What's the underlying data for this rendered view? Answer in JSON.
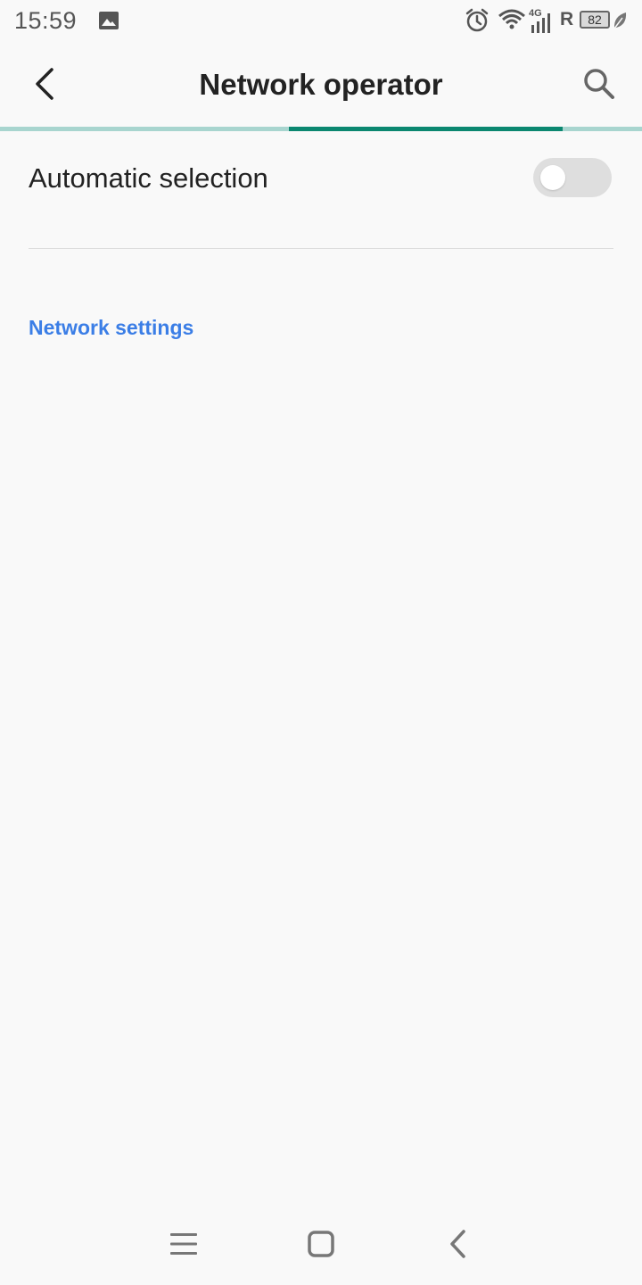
{
  "status_bar": {
    "time": "15:59",
    "network_type": "4G",
    "roaming_indicator": "R",
    "battery_level": "82",
    "icons": [
      "image-icon",
      "alarm-icon",
      "wifi-icon",
      "signal-icon",
      "battery-icon",
      "leaf-icon"
    ]
  },
  "app_bar": {
    "title": "Network operator",
    "back_icon": "chevron-left-icon",
    "search_icon": "search-icon"
  },
  "progress": {
    "fraction": 0.43
  },
  "settings": {
    "automatic_selection": {
      "label": "Automatic selection",
      "enabled": false
    },
    "section_link": "Network settings"
  },
  "nav_bar": {
    "icons": [
      "menu-icon",
      "home-icon",
      "back-icon"
    ]
  },
  "colors": {
    "background": "#f9f9f9",
    "accent": "#0b8770",
    "accent_light": "#a8d5cf",
    "link": "#3b7ee6",
    "text": "#222222",
    "toggle_off": "#dedede"
  }
}
